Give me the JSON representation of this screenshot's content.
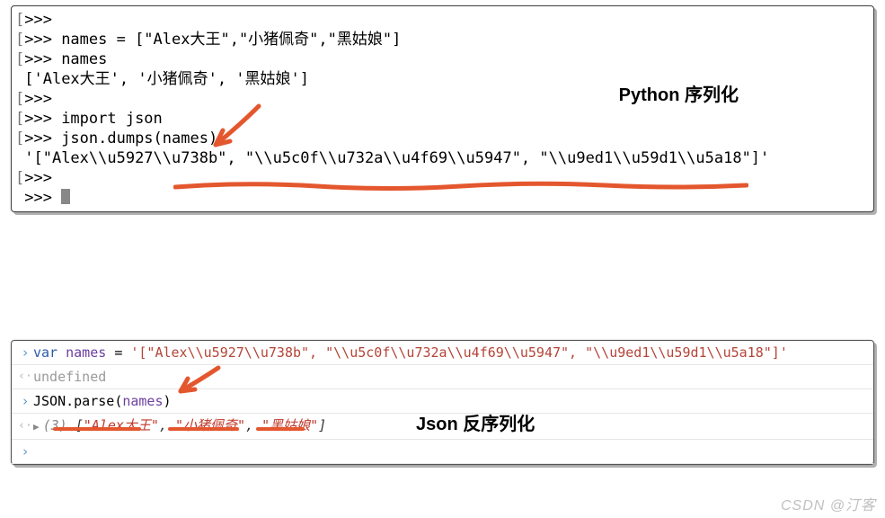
{
  "top": {
    "l1_text": ">>>",
    "l2_text": ">>> names = [\"Alex大王\",\"小猪佩奇\",\"黑姑娘\"]",
    "l3_text": ">>> names",
    "l4_text": "['Alex大王', '小猪佩奇', '黑姑娘']",
    "l5_text": ">>>",
    "l6_text": ">>> import json",
    "l7_text": ">>> json.dumps(names)",
    "l8_text": "'[\"Alex\\\\u5927\\\\u738b\", \"\\\\u5c0f\\\\u732a\\\\u4f69\\\\u5947\", \"\\\\u9ed1\\\\u59d1\\\\u5a18\"]'",
    "l9_text": ">>>",
    "l10_text": ">>> "
  },
  "labels": {
    "python": "Python 序列化",
    "json": "Json 反序列化"
  },
  "bottom": {
    "r1_kw": "var",
    "r1_name": " names ",
    "r1_eq": "= ",
    "r1_str": "'[\"Alex\\\\u5927\\\\u738b\", \"\\\\u5c0f\\\\u732a\\\\u4f69\\\\u5947\", \"\\\\u9ed1\\\\u59d1\\\\u5a18\"]'",
    "r2": "undefined",
    "r3_fn": "JSON.parse",
    "r3_paren_open": "(",
    "r3_arg": "names",
    "r3_paren_close": ")",
    "r4_count": "(3) ",
    "r4_open": "[",
    "r4_v1": "\"Alex大王\"",
    "r4_c1": ", ",
    "r4_v2": "\"小猪佩奇\"",
    "r4_c2": ", ",
    "r4_v3": "\"黑姑娘\"",
    "r4_close": "]"
  },
  "watermark": "CSDN @汀客"
}
